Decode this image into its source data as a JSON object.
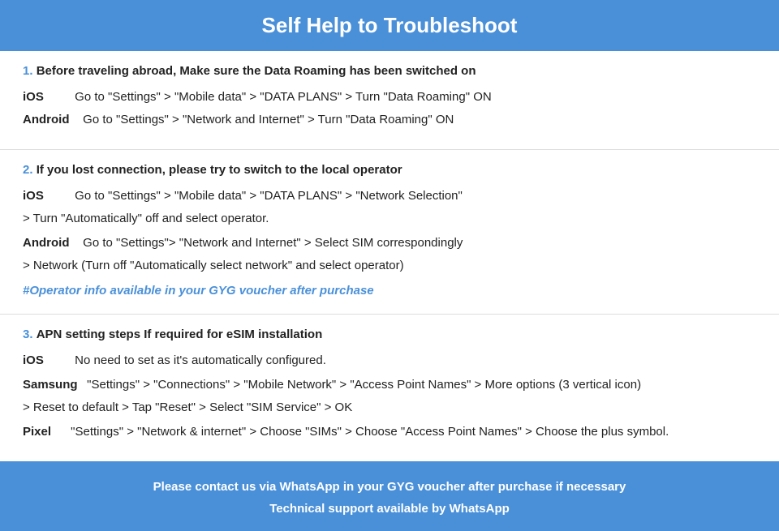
{
  "header": {
    "title": "Self Help to Troubleshoot"
  },
  "sections": [
    {
      "id": "section1",
      "num": "1.",
      "title": "Before traveling abroad, Make sure the Data Roaming has been switched on",
      "instructions": [
        {
          "label": "iOS",
          "text": "Go to \"Settings\" > \"Mobile data\" > \"DATA PLANS\" > Turn \"Data Roaming\" ON",
          "continuation": null
        },
        {
          "label": "Android",
          "text": "Go to \"Settings\" > \"Network and Internet\" > Turn \"Data Roaming\" ON",
          "continuation": null
        }
      ],
      "note": null
    },
    {
      "id": "section2",
      "num": "2.",
      "title": "If you lost connection, please try to switch to the local operator",
      "instructions": [
        {
          "label": "iOS",
          "text": "Go to \"Settings\" > \"Mobile data\" > \"DATA PLANS\" > \"Network Selection\"",
          "continuation": "> Turn \"Automatically\" off and select operator."
        },
        {
          "label": "Android",
          "text": "Go to \"Settings\">  \"Network and Internet\" > Select SIM correspondingly",
          "continuation": "> Network (Turn off \"Automatically select network\" and select operator)"
        }
      ],
      "note": "#Operator info available in your GYG voucher after purchase"
    },
    {
      "id": "section3",
      "num": "3.",
      "title": "APN setting steps If required for eSIM installation",
      "instructions": [
        {
          "label": "iOS",
          "text": "No need to set as it's automatically configured.",
          "continuation": null
        },
        {
          "label": "Samsung",
          "text": "\"Settings\" > \"Connections\" > \"Mobile Network\" > \"Access Point Names\" > More options (3 vertical icon)",
          "continuation": "> Reset to default > Tap \"Reset\" > Select \"SIM Service\" > OK"
        },
        {
          "label": "Pixel",
          "text": "\"Settings\" > \"Network & internet\" > Choose \"SIMs\" > Choose \"Access Point Names\" > Choose the plus symbol.",
          "continuation": null
        }
      ],
      "note": null
    }
  ],
  "footer": {
    "line1": "Please contact us via WhatsApp  in your GYG voucher after purchase if necessary",
    "line2": "Technical support available by WhatsApp"
  }
}
